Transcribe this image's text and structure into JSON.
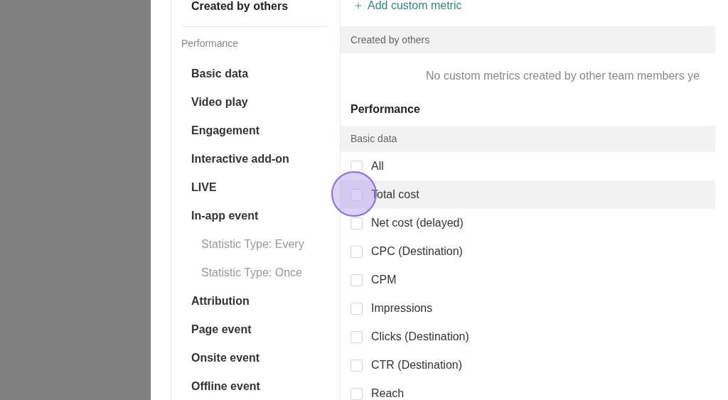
{
  "sidebar": {
    "top_item": "Created by others",
    "section": "Performance",
    "items": [
      {
        "label": "Basic data"
      },
      {
        "label": "Video play"
      },
      {
        "label": "Engagement"
      },
      {
        "label": "Interactive add-on"
      },
      {
        "label": "LIVE"
      },
      {
        "label": "In-app event",
        "children": [
          {
            "label": "Statistic Type: Every"
          },
          {
            "label": "Statistic Type: Once"
          }
        ]
      },
      {
        "label": "Attribution"
      },
      {
        "label": "Page event"
      },
      {
        "label": "Onsite event"
      },
      {
        "label": "Offline event"
      }
    ]
  },
  "main": {
    "add_link": "Add custom metric",
    "others_header": "Created by others",
    "empty_message": "No custom metrics created by other team members ye",
    "section": "Performance",
    "group_header": "Basic data",
    "metrics": [
      {
        "label": "All",
        "checked": false,
        "hovered": false
      },
      {
        "label": "Total cost",
        "checked": false,
        "hovered": true
      },
      {
        "label": "Net cost (delayed)",
        "checked": false,
        "hovered": false
      },
      {
        "label": "CPC (Destination)",
        "checked": false,
        "hovered": false
      },
      {
        "label": "CPM",
        "checked": false,
        "hovered": false
      },
      {
        "label": "Impressions",
        "checked": false,
        "hovered": false
      },
      {
        "label": "Clicks (Destination)",
        "checked": false,
        "hovered": false
      },
      {
        "label": "CTR (Destination)",
        "checked": false,
        "hovered": false
      },
      {
        "label": "Reach",
        "checked": false,
        "hovered": false
      }
    ]
  }
}
